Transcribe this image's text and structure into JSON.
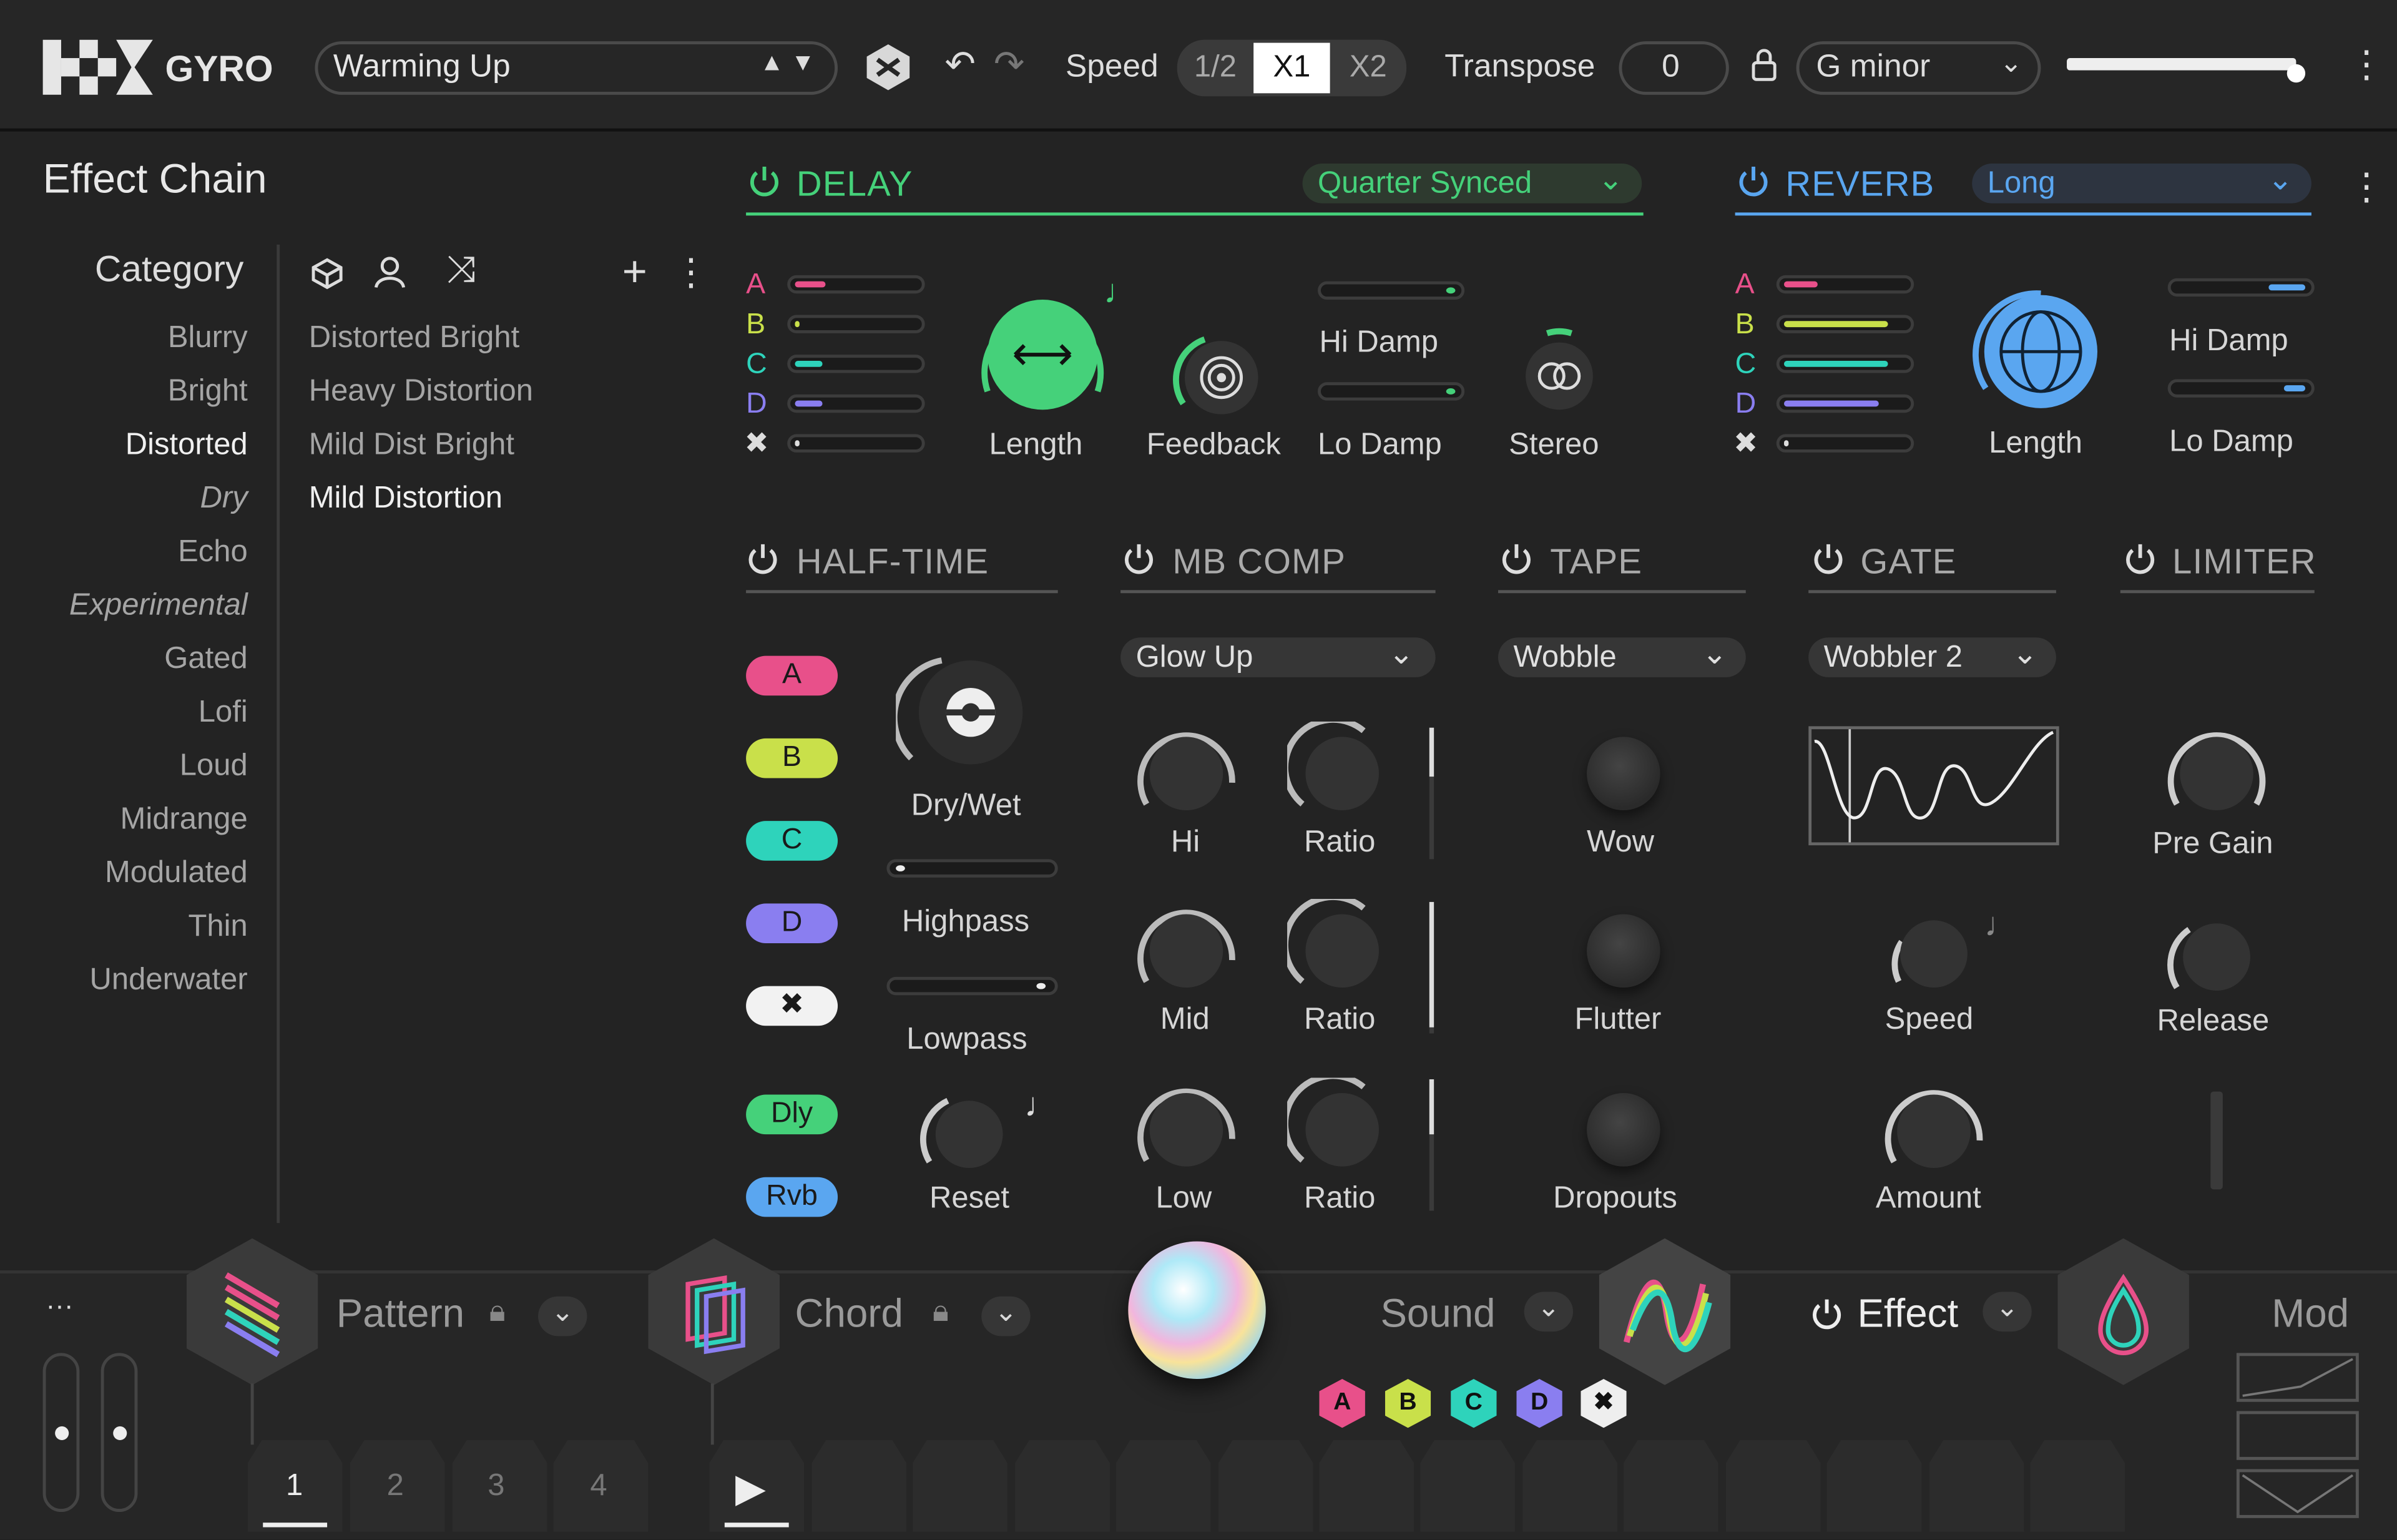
{
  "app": {
    "name": "GYRO"
  },
  "topbar": {
    "preset": "Warming Up",
    "speed_label": "Speed",
    "speed_options": [
      "1/2",
      "X1",
      "X2"
    ],
    "speed_selected": "X1",
    "transpose_label": "Transpose",
    "transpose_value": "0",
    "key": "G minor",
    "volume_level": 0.95
  },
  "browser": {
    "title": "Effect Chain",
    "category_header": "Category",
    "categories": [
      "Blurry",
      "Bright",
      "Distorted",
      "Dry",
      "Echo",
      "Experimental",
      "Gated",
      "Lofi",
      "Loud",
      "Midrange",
      "Modulated",
      "Thin",
      "Underwater"
    ],
    "selected_category": "Distorted",
    "presets": [
      "Distorted Bright",
      "Heavy Distortion",
      "Mild Dist Bright",
      "Mild Distortion"
    ],
    "selected_preset": "Mild Distortion"
  },
  "delay": {
    "title": "DELAY",
    "mode": "Quarter Synced",
    "sends": [
      "A",
      "B",
      "C",
      "D"
    ],
    "knobs": {
      "length": "Length",
      "feedback": "Feedback",
      "hi_damp": "Hi Damp",
      "lo_damp": "Lo Damp",
      "stereo": "Stereo"
    }
  },
  "reverb": {
    "title": "REVERB",
    "mode": "Long",
    "sends": [
      "A",
      "B",
      "C",
      "D"
    ],
    "knobs": {
      "length": "Length",
      "hi_damp": "Hi Damp",
      "lo_damp": "Lo Damp"
    }
  },
  "halftime": {
    "title": "HALF-TIME",
    "tags": [
      "A",
      "B",
      "C",
      "D",
      "Dly",
      "Rvb"
    ],
    "labels": {
      "drywet": "Dry/Wet",
      "highpass": "Highpass",
      "lowpass": "Lowpass",
      "reset": "Reset"
    }
  },
  "mbcomp": {
    "title": "MB COMP",
    "preset": "Glow Up",
    "labels": {
      "hi": "Hi",
      "mid": "Mid",
      "low": "Low",
      "ratio": "Ratio"
    }
  },
  "tape": {
    "title": "TAPE",
    "preset": "Wobble",
    "labels": {
      "wow": "Wow",
      "flutter": "Flutter",
      "dropouts": "Dropouts"
    }
  },
  "gate": {
    "title": "GATE",
    "preset": "Wobbler 2",
    "labels": {
      "speed": "Speed",
      "amount": "Amount"
    }
  },
  "limiter": {
    "title": "LIMITER",
    "labels": {
      "pregain": "Pre Gain",
      "release": "Release"
    }
  },
  "bottom": {
    "menu": "···",
    "pattern": "Pattern",
    "chord": "Chord",
    "sound": "Sound",
    "effect": "Effect",
    "mod": "Mod",
    "badges": [
      "A",
      "B",
      "C",
      "D"
    ],
    "steps": [
      "1",
      "2",
      "3",
      "4"
    ]
  },
  "colors": {
    "delay": "#45d17a",
    "reverb": "#5aa6f0",
    "a": "#e8508a",
    "b": "#c9e04a",
    "c": "#2ed3bb",
    "d": "#8a7ef0"
  }
}
